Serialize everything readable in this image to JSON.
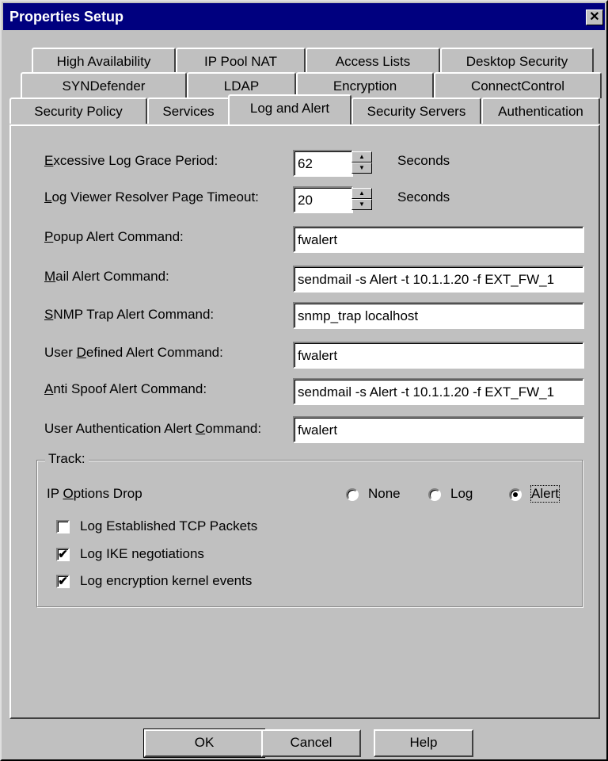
{
  "window": {
    "title": "Properties Setup",
    "close_glyph": "✕"
  },
  "tabs": {
    "row1": [
      "High Availability",
      "IP Pool NAT",
      "Access Lists",
      "Desktop Security"
    ],
    "row2": [
      "SYNDefender",
      "LDAP",
      "Encryption",
      "ConnectControl"
    ],
    "row3": [
      "Security Policy",
      "Services",
      "Log and Alert",
      "Security Servers",
      "Authentication"
    ],
    "active": "Log and Alert"
  },
  "fields": {
    "grace_period": {
      "label": "Excessive Log Grace Period:",
      "accel": "E",
      "value": "62",
      "unit": "Seconds"
    },
    "resolver_timeout": {
      "label": "Log Viewer Resolver Page Timeout:",
      "accel": "L",
      "value": "20",
      "unit": "Seconds"
    },
    "popup_alert": {
      "label": "Popup Alert Command:",
      "accel": "P",
      "value": "fwalert"
    },
    "mail_alert": {
      "label": "Mail Alert Command:",
      "accel": "M",
      "value": "sendmail -s Alert -t 10.1.1.20 -f EXT_FW_1"
    },
    "snmp_alert": {
      "label": "SNMP Trap Alert Command:",
      "accel": "S",
      "value": "snmp_trap localhost"
    },
    "user_defined_alert": {
      "label": "User Defined Alert Command:",
      "accel": "D",
      "value": "fwalert"
    },
    "anti_spoof_alert": {
      "label": "Anti Spoof Alert Command:",
      "accel": "A",
      "value": "sendmail -s Alert -t 10.1.1.20 -f EXT_FW_1"
    },
    "user_auth_alert": {
      "label": "User Authentication Alert Command:",
      "accel": "C",
      "value": "fwalert"
    }
  },
  "track": {
    "legend": "Track:",
    "ip_options_label": "IP Options Drop",
    "radios": [
      {
        "label": "None",
        "selected": false
      },
      {
        "label": "Log",
        "selected": false
      },
      {
        "label": "Alert",
        "selected": true
      }
    ],
    "checkboxes": [
      {
        "label": "Log Established TCP Packets",
        "checked": false
      },
      {
        "label": "Log IKE negotiations",
        "checked": true
      },
      {
        "label": "Log encryption kernel events",
        "checked": true
      }
    ]
  },
  "buttons": {
    "ok": "OK",
    "cancel": "Cancel",
    "help": "Help"
  },
  "icons": {
    "spin_up": "▲",
    "spin_down": "▼",
    "check": "✔"
  }
}
